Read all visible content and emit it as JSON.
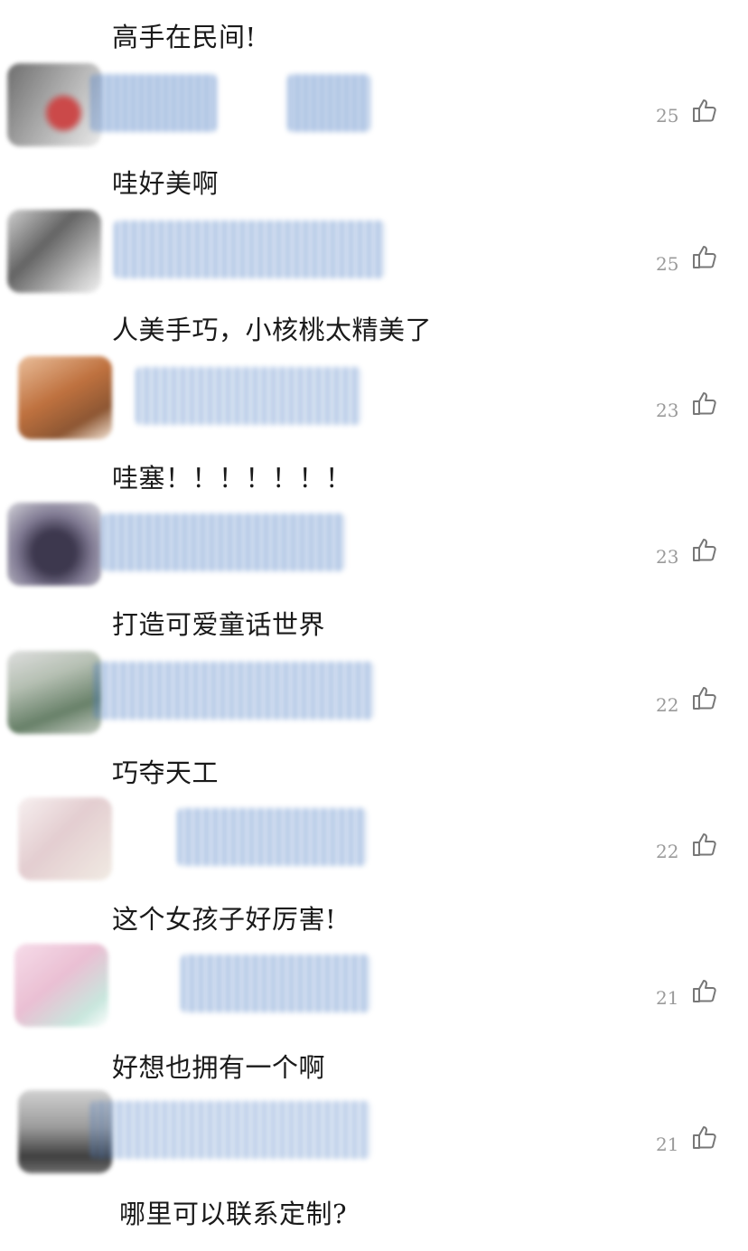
{
  "comments": [
    {
      "text": "高手在民间!",
      "likes": "",
      "avatar_color": "#888888",
      "accent": "#c22a2a"
    },
    {
      "text": "哇好美啊",
      "likes": "25",
      "avatar_color": "#666666",
      "accent": "#3e6fb8"
    },
    {
      "text": "人美手巧，小核桃太精美了",
      "likes": "25",
      "avatar_color": "#b4591e",
      "accent": "#4f7fc4"
    },
    {
      "text": "哇塞！！！！！！！",
      "likes": "23",
      "avatar_color": "#2a2340",
      "accent": "#4f7fc4"
    },
    {
      "text": "打造可爱童话世界",
      "likes": "23",
      "avatar_color": "#5a7a5a",
      "accent": "#4f7fc4"
    },
    {
      "text": "巧夺天工",
      "likes": "22",
      "avatar_color": "#d8b9bd",
      "accent": "#4f7fc4"
    },
    {
      "text": "这个女孩子好厉害!",
      "likes": "22",
      "avatar_color": "#e7b5cc",
      "accent": "#4f7fc4"
    },
    {
      "text": "好想也拥有一个啊",
      "likes": "21",
      "avatar_color": "#2d2d2d",
      "accent": "#4f7fc4"
    },
    {
      "text": "哪里可以联系定制?",
      "likes": "21",
      "avatar_color": "",
      "accent": ""
    }
  ],
  "icons": {
    "like": "thumbs-up-outline-icon"
  },
  "colors": {
    "text": "#1a1a1a",
    "count": "#9a9a9a",
    "smudge_blue": "#4f7fc4"
  }
}
